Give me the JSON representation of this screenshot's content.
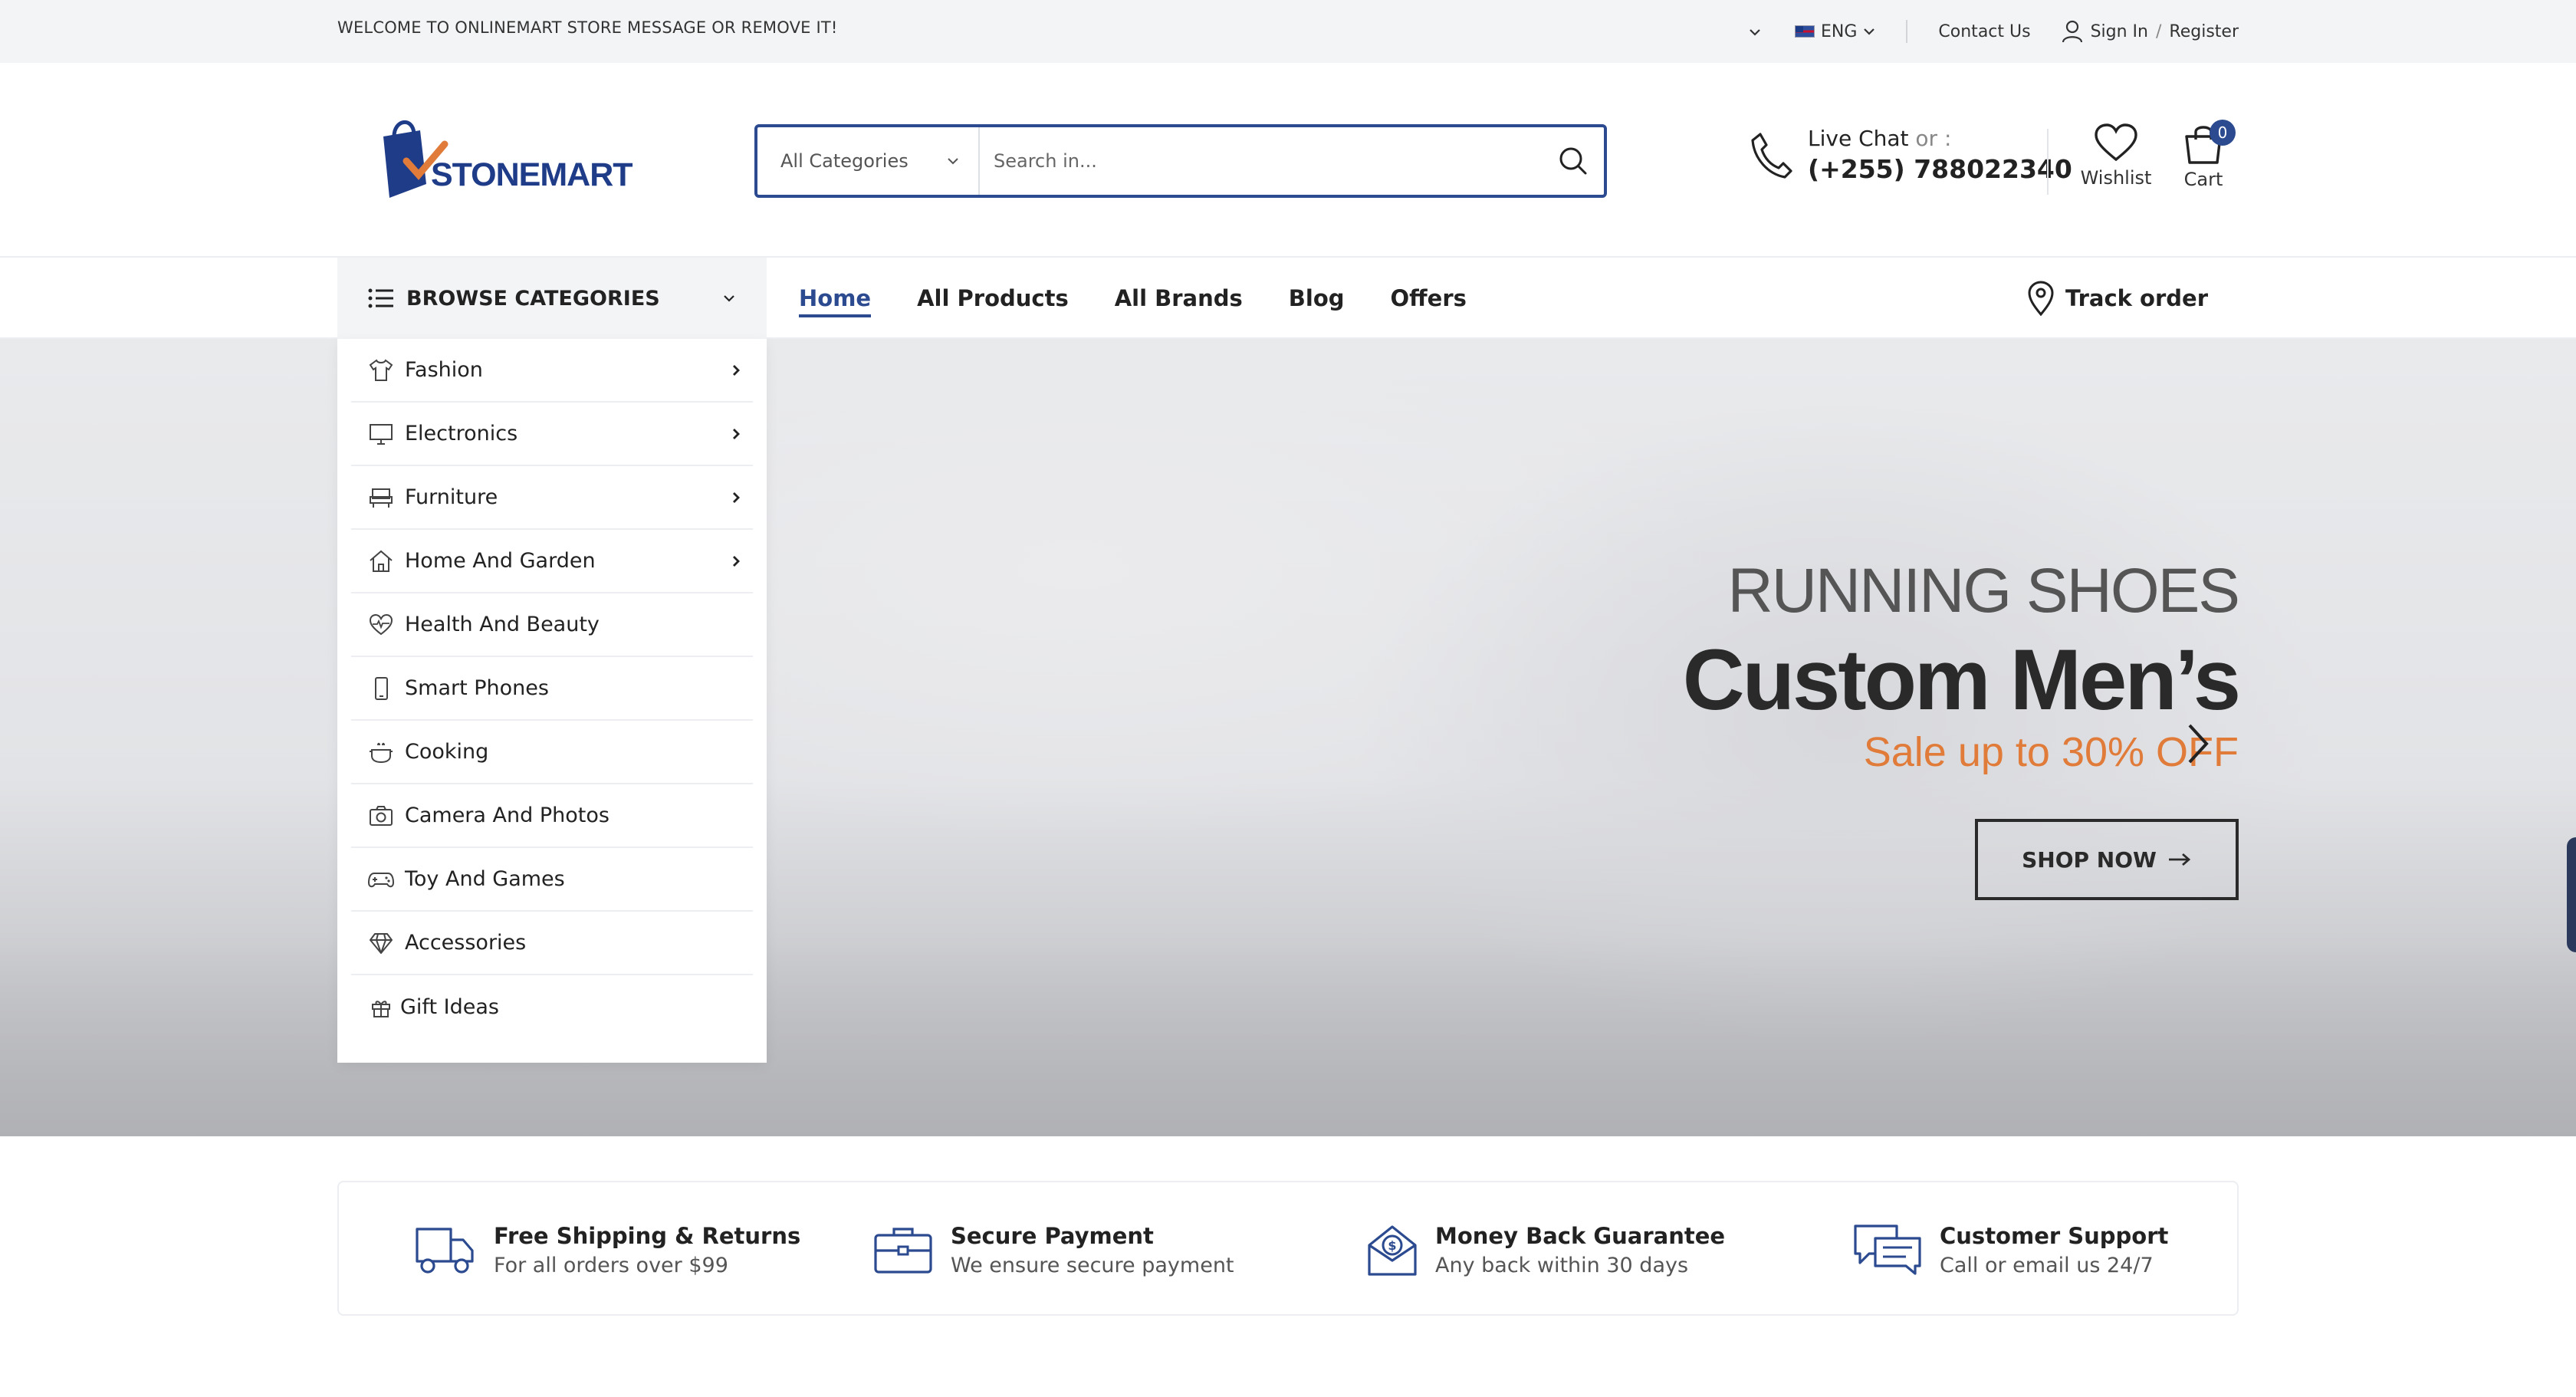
{
  "topbar": {
    "welcome": "WELCOME TO ONLINEMART STORE MESSAGE OR REMOVE IT!",
    "language": "ENG",
    "contact": "Contact Us",
    "sign_in": "Sign In",
    "separator": "/",
    "register": "Register"
  },
  "header": {
    "logo_text": "STONEMART",
    "search": {
      "category": "All Categories",
      "placeholder": "Search in..."
    },
    "live_chat": "Live Chat",
    "or": "or :",
    "phone": "(+255) 788022340",
    "wishlist": "Wishlist",
    "cart": "Cart",
    "cart_count": "0"
  },
  "nav": {
    "browse": "BROWSE CATEGORIES",
    "items": [
      "Home",
      "All Products",
      "All Brands",
      "Blog",
      "Offers"
    ],
    "active": "Home",
    "track": "Track order"
  },
  "categories": [
    {
      "label": "Fashion",
      "icon": "tshirt-icon",
      "arrow": true
    },
    {
      "label": "Electronics",
      "icon": "monitor-icon",
      "arrow": true
    },
    {
      "label": "Furniture",
      "icon": "sofa-icon",
      "arrow": true
    },
    {
      "label": "Home And Garden",
      "icon": "home-icon",
      "arrow": true
    },
    {
      "label": "Health And Beauty",
      "icon": "heart-pulse-icon",
      "arrow": false
    },
    {
      "label": "Smart Phones",
      "icon": "smartphone-icon",
      "arrow": false
    },
    {
      "label": "Cooking",
      "icon": "cooking-pot-icon",
      "arrow": false
    },
    {
      "label": "Camera And Photos",
      "icon": "camera-icon",
      "arrow": false
    },
    {
      "label": "Toy And Games",
      "icon": "gamepad-icon",
      "arrow": false
    },
    {
      "label": "Accessories",
      "icon": "diamond-icon",
      "arrow": false
    },
    {
      "label": "Gift Ideas",
      "icon": "gift-icon",
      "arrow": false
    }
  ],
  "hero": {
    "subtitle": "RUNNING SHOES",
    "title": "Custom Men’s",
    "sale": "Sale up to 30% OFF",
    "button": "SHOP NOW"
  },
  "features": [
    {
      "title": "Free Shipping & Returns",
      "subtitle": "For all orders over $99",
      "icon": "truck-icon"
    },
    {
      "title": "Secure Payment",
      "subtitle": "We ensure secure payment",
      "icon": "briefcase-icon"
    },
    {
      "title": "Money Back Guarantee",
      "subtitle": "Any back within 30 days",
      "icon": "money-envelope-icon"
    },
    {
      "title": "Customer Support",
      "subtitle": "Call or email us 24/7",
      "icon": "chat-icon"
    }
  ],
  "colors": {
    "brand": "#2b4a8f",
    "accent": "#e07b39",
    "topbar_bg": "#f3f4f6"
  }
}
